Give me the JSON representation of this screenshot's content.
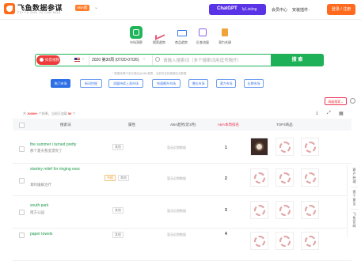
{
  "header": {
    "brand": "飞鱼数据参谋",
    "brand_sub": "FEI YU SHU JU CAN MOU",
    "badge": "ABA版",
    "chatgpt_label": "ChatGPT",
    "chatgpt_sub": "写Listing",
    "member_center": "会员中心",
    "install_plugin": "安装插件",
    "login_button": "登录 / 注册"
  },
  "tools": [
    {
      "label": "市场洞察",
      "icon": "grid-icon"
    },
    {
      "label": "搜索趋势",
      "icon": "chart-icon"
    },
    {
      "label": "商品趋势",
      "icon": "cart-icon"
    },
    {
      "label": "反查流量",
      "icon": "search-doc-icon"
    },
    {
      "label": "潜力关键",
      "icon": "bookmark-icon"
    }
  ],
  "search": {
    "hot_video": "抖音视频",
    "marketplace": "US",
    "week": "2020 第30周 (07/20-07/26)",
    "placeholder": "请输入搜索词（多个搜索词用逗号隔开）",
    "button": "搜 索",
    "note": "* 数据来源于亚马逊后台ABA报表，当前仅支持美国站点数据"
  },
  "filters": [
    "热门市场",
    "新词挖掘",
    "流量持续上涨市场",
    "快速飙升市场",
    "增长市场",
    "潜力市场",
    "长期市场"
  ],
  "toolbar": {
    "sort_label": "高级搜索",
    "count_prefix": "共",
    "count_value": "10000+",
    "count_suffix": "个结果，当前已加载",
    "count_loaded": "50",
    "count_tail": "个"
  },
  "table": {
    "headers": [
      "搜索词",
      "属性",
      "ABA趋势(近3月)",
      "ABA本周排名",
      "TOP3商品"
    ],
    "rows": [
      {
        "term": "the summer i turned pretty",
        "cn": "那个夏天我变漂亮了",
        "tags": [
          "其他"
        ],
        "trend": "暂无近期数据",
        "rank": "1"
      },
      {
        "term": "stanley relief for ringing ears",
        "cn": "耳鸣缓解治疗",
        "tags": [
          "节假",
          "其他"
        ],
        "trend": "暂无近期数据",
        "rank": "2"
      },
      {
        "term": "south park",
        "cn": "南方公园",
        "tags": [
          "其他"
        ],
        "trend": "暂无近期数据",
        "rank": "3"
      },
      {
        "term": "paper towels",
        "cn": "纸巾",
        "tags": [
          "其他"
        ],
        "trend": "暂无近期数据",
        "rank": "4"
      }
    ]
  },
  "side": {
    "a": "客户经理",
    "b": "提个意见",
    "c": "飞鱼官网"
  },
  "colors": {
    "accent": "#1fb157",
    "brand": "#ff6a1f",
    "chatgpt": "#5a33e6",
    "chip": "#2d6fe6"
  }
}
